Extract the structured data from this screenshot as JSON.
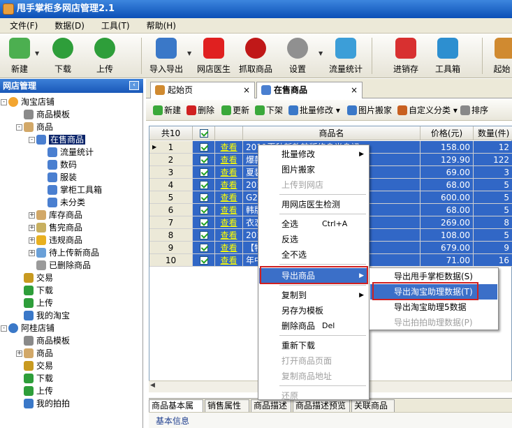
{
  "window": {
    "title": "甩手掌柜多网店管理2.1"
  },
  "menu": [
    "文件(F)",
    "数据(D)",
    "工具(T)",
    "帮助(H)"
  ],
  "toolbar": [
    {
      "label": "新建",
      "icon": "new-icon",
      "color": "#4caf50"
    },
    {
      "label": "下载",
      "icon": "download-icon",
      "color": "#2e9e3a"
    },
    {
      "label": "上传",
      "icon": "upload-icon",
      "color": "#2e9e3a"
    },
    {
      "label": "导入导出",
      "icon": "import-export-icon",
      "color": "#3a78c8"
    },
    {
      "label": "网店医生",
      "icon": "doctor-icon",
      "color": "#e02020"
    },
    {
      "label": "抓取商品",
      "icon": "spider-icon",
      "color": "#c01818"
    },
    {
      "label": "设置",
      "icon": "gear-icon",
      "color": "#909090"
    },
    {
      "label": "流量统计",
      "icon": "chart-icon",
      "color": "#3c9ed8"
    },
    {
      "label": "进销存",
      "icon": "inventory-icon",
      "color": "#d83030"
    },
    {
      "label": "工具箱",
      "icon": "toolbox-icon",
      "color": "#2d8fd0"
    },
    {
      "label": "起始",
      "icon": "home-icon",
      "color": "#d08a30"
    }
  ],
  "sidebar": {
    "title": "网店管理",
    "pin_label": "‹",
    "tree": [
      {
        "label": "淘宝店铺",
        "icon": "taobao-shop-icon",
        "color": "#f3a530"
      },
      {
        "label": "商品模板",
        "icon": "template-icon",
        "color": "#8a8a8a"
      },
      {
        "label": "商品",
        "icon": "goods-icon",
        "color": "#d2a868"
      },
      {
        "label": "在售商品",
        "icon": "onsale-icon",
        "color": "#4a7fd0"
      },
      {
        "label": "流量统计",
        "icon": "traffic-icon",
        "color": "#4a7fd0"
      },
      {
        "label": "数码",
        "icon": "category-icon",
        "color": "#4a7fd0"
      },
      {
        "label": "服装",
        "icon": "category-icon",
        "color": "#4a7fd0"
      },
      {
        "label": "掌柜工具箱",
        "icon": "category-icon",
        "color": "#4a7fd0"
      },
      {
        "label": "未分类",
        "icon": "category-icon",
        "color": "#4a7fd0"
      },
      {
        "label": "库存商品",
        "icon": "stock-icon",
        "color": "#d2a868"
      },
      {
        "label": "售完商品",
        "icon": "soldout-icon",
        "color": "#c8b060"
      },
      {
        "label": "违规商品",
        "icon": "warning-icon",
        "color": "#e8b020"
      },
      {
        "label": "待上传新商品",
        "icon": "pending-icon",
        "color": "#6aa0d8"
      },
      {
        "label": "已删除商品",
        "icon": "trash-icon",
        "color": "#9a9a9a"
      },
      {
        "label": "交易",
        "icon": "trade-icon",
        "color": "#c89a20"
      },
      {
        "label": "下载",
        "icon": "download-icon",
        "color": "#2e9e3a"
      },
      {
        "label": "上传",
        "icon": "upload-icon",
        "color": "#2e9e3a"
      },
      {
        "label": "我的淘宝",
        "icon": "my-taobao-icon",
        "color": "#3a78c8"
      },
      {
        "label": "阿桂店铺",
        "icon": "paipai-shop-icon",
        "color": "#3a78c8"
      },
      {
        "label": "商品模板",
        "icon": "template-icon",
        "color": "#8a8a8a"
      },
      {
        "label": "商品",
        "icon": "goods-icon",
        "color": "#d2a868"
      },
      {
        "label": "交易",
        "icon": "trade-icon",
        "color": "#c89a20"
      },
      {
        "label": "下载",
        "icon": "download-icon",
        "color": "#2e9e3a"
      },
      {
        "label": "上传",
        "icon": "upload-icon",
        "color": "#2e9e3a"
      },
      {
        "label": "我的拍拍",
        "icon": "my-paipai-icon",
        "color": "#3a78c8"
      }
    ]
  },
  "tabs": [
    {
      "label": "起始页",
      "close": "×"
    },
    {
      "label": "在售商品",
      "close": "×"
    }
  ],
  "panel_toolbar": [
    {
      "label": "新建",
      "icon": "new-icon",
      "color": "#3aa83a"
    },
    {
      "label": "删除",
      "icon": "delete-icon",
      "color": "#d02020"
    },
    {
      "label": "更新",
      "icon": "refresh-icon",
      "color": "#3aa83a"
    },
    {
      "label": "下架",
      "icon": "down-arrow-icon",
      "color": "#3aa83a"
    },
    {
      "label": "批量修改 ▾",
      "icon": "batch-edit-icon",
      "color": "#3a78c8"
    },
    {
      "label": "图片搬家",
      "icon": "picture-icon",
      "color": "#3a78c8"
    },
    {
      "label": "自定义分类 ▾",
      "icon": "category-icon",
      "color": "#c86020"
    },
    {
      "label": "排序",
      "icon": "sort-icon",
      "color": "#888888"
    }
  ],
  "grid": {
    "count_label": "共10",
    "headers": {
      "name": "商品名",
      "price": "价格(元)",
      "qty": "数量(件)"
    },
    "view_label": "查看",
    "rows": [
      {
        "num": "1",
        "name": "2011夏秋新款韩版修身半身裙",
        "price": "158.00",
        "qty": "12"
      },
      {
        "num": "2",
        "name": "爆款男士休闲裤 男牛津",
        "price": "129.90",
        "qty": "122"
      },
      {
        "num": "3",
        "name": "夏装新款韩版印花色",
        "price": "69.00",
        "qty": "3"
      },
      {
        "num": "4",
        "name": "2011新款百搭布蝴蝶结",
        "price": "68.00",
        "qty": "5"
      },
      {
        "num": "5",
        "name": "G2011女装商务结婚",
        "price": "600.00",
        "qty": "5"
      },
      {
        "num": "6",
        "name": "韩版宽松针织纺短袖",
        "price": "68.00",
        "qty": "5"
      },
      {
        "num": "7",
        "name": "衣恋韩版泡泡肩花雪纺",
        "price": "269.00",
        "qty": "8"
      },
      {
        "num": "8",
        "name": "2011新款半开襟荷",
        "price": "108.00",
        "qty": "5"
      },
      {
        "num": "9",
        "name": "【特价】韩版气质女",
        "price": "679.00",
        "qty": "9"
      },
      {
        "num": "10",
        "name": "年中大促潮男T恤",
        "price": "71.00",
        "qty": "16"
      }
    ]
  },
  "bottom_tabs": [
    "商品基本属性",
    "销售属性",
    "商品描述",
    "商品描述预览",
    "关联商品"
  ],
  "basic_info_label": "基本信息",
  "context_menu": {
    "items": [
      {
        "label": "批量修改",
        "arrow": "▶",
        "disabled": false
      },
      {
        "label": "图片搬家",
        "disabled": false
      },
      {
        "label": "上传到网店",
        "disabled": true
      },
      {
        "label": "用网店医生检测",
        "disabled": false
      },
      {
        "label": "全选",
        "shortcut": "Ctrl+A",
        "disabled": false
      },
      {
        "label": "反选",
        "disabled": false
      },
      {
        "label": "全不选",
        "disabled": false
      },
      {
        "label": "导出商品",
        "arrow": "▶",
        "disabled": false,
        "highlighted": true
      },
      {
        "label": "复制到",
        "arrow": "▶",
        "disabled": false
      },
      {
        "label": "另存为模板",
        "disabled": false
      },
      {
        "label": "删除商品",
        "shortcut": "Del",
        "disabled": false
      },
      {
        "label": "重新下载",
        "disabled": false
      },
      {
        "label": "打开商品页面",
        "disabled": true
      },
      {
        "label": "复制商品地址",
        "disabled": true
      },
      {
        "label": "还原",
        "disabled": true
      }
    ],
    "submenu": [
      {
        "label": "导出甩手掌柜数据(S)",
        "disabled": false
      },
      {
        "label": "导出淘宝助理数据(T)",
        "disabled": false,
        "highlighted": true
      },
      {
        "label": "导出淘宝助理5数据",
        "disabled": false
      },
      {
        "label": "导出拍拍助理数据(P)",
        "disabled": true
      }
    ]
  },
  "colors": {
    "selection": "#3167c6",
    "highlight": "#3b6fc8",
    "callout": "#d02020",
    "titlebar": "#0b4fb6"
  }
}
